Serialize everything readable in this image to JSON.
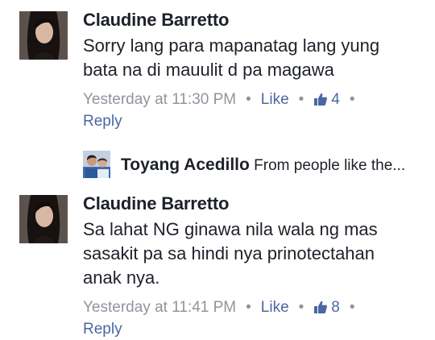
{
  "comments": [
    {
      "author": "Claudine Barretto",
      "text": "Sorry lang para mapanatag lang yung bata na di mauulit d pa magawa",
      "time": "Yesterday at 11:30 PM",
      "like_label": "Like",
      "like_count": "4",
      "reply_label": "Reply"
    },
    {
      "author": "Claudine Barretto",
      "text": "Sa lahat NG ginawa nila wala ng mas sasakit pa sa hindi nya prinotectahan anak nya.",
      "time": "Yesterday at 11:41 PM",
      "like_label": "Like",
      "like_count": "8",
      "reply_label": "Reply"
    }
  ],
  "reply_preview": {
    "author": "Toyang Acedillo",
    "snippet": "From people like the..."
  },
  "colors": {
    "author_text": "#1d2129",
    "meta_gray": "#90949c",
    "link_blue": "#4b67a1"
  },
  "icons": {
    "like": "thumbs-up-icon",
    "separator": "dot-separator"
  }
}
